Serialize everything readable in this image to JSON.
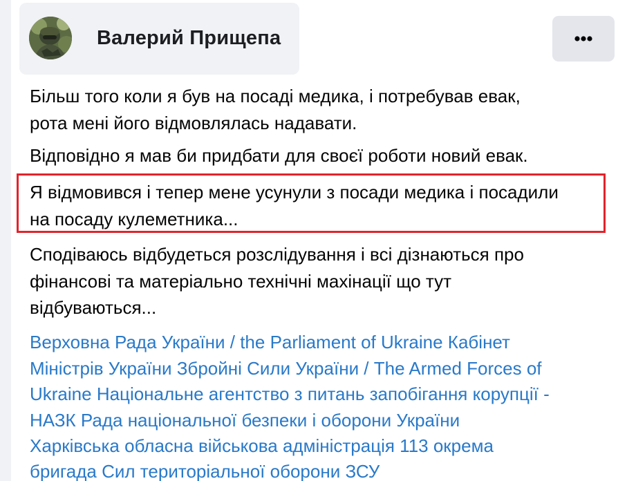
{
  "post": {
    "author": "Валерий Прищепа",
    "more_button_label": "",
    "paragraphs": {
      "p1": {
        "line1": "Більш того коли я був на посаді медика, і потребував евак,",
        "line2": "рота мені його відмовлялась надавати."
      },
      "p2": {
        "line1": "Відповідно я мав би придбати для своєї роботи новий евак."
      },
      "p3": {
        "line1": "Я відмовився і тепер мене усунули з посади медика і посадили",
        "line2": "на посаду кулеметника..."
      },
      "p4": {
        "line1": "Сподіваюсь відбудеться розслідування і всі дізнаються про",
        "line2": "фінансові та матеріально технічні махінації що тут",
        "line3": "відбуваються..."
      }
    },
    "tags": {
      "line1": "Верховна Рада України / the Parliament of Ukraine Кабінет",
      "line2": "Міністрів України Збройні Сили України / The Armed Forces of",
      "line3": "Ukraine Національне агентство з питань запобігання корупції -",
      "line4": "НАЗК Рада національної безпеки і оборони України",
      "line5": "Харківська обласна військова адміністрація 113 окрема",
      "line6": "бригада Сил територіальної оборони ЗСУ"
    },
    "colors": {
      "link": "#2979c9",
      "highlight": "#e2232b",
      "header_bg": "#f0f2f5",
      "button_bg": "#e4e6eb"
    },
    "icons": {
      "more": "more-horizontal-icon",
      "avatar": "profile-photo"
    }
  }
}
